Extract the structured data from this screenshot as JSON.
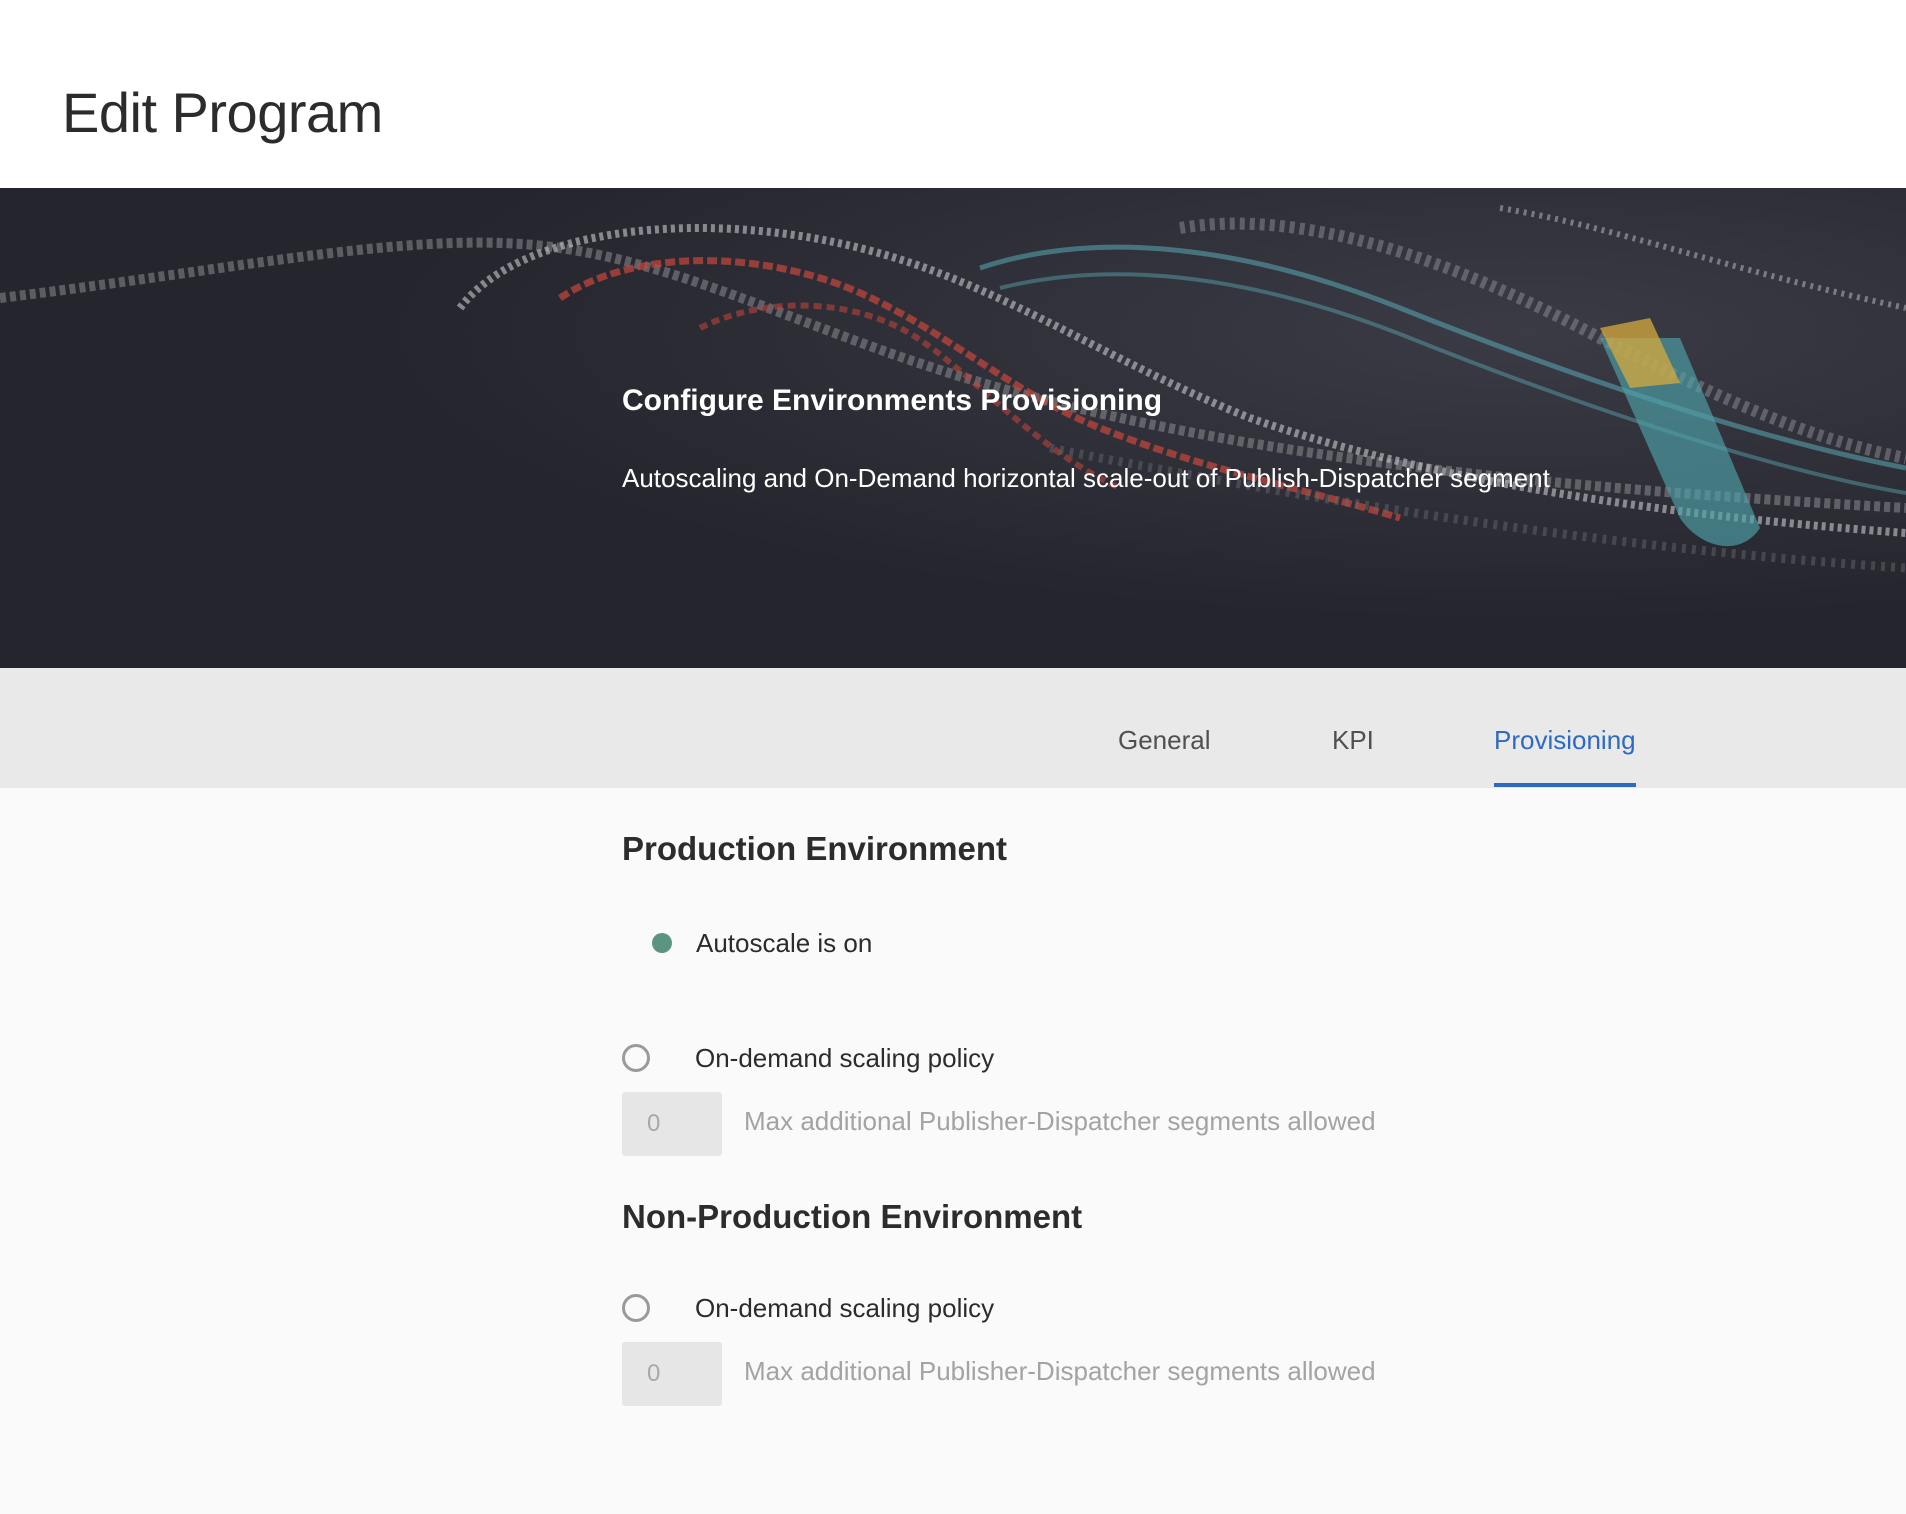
{
  "page": {
    "title": "Edit Program"
  },
  "hero": {
    "title": "Configure Environments Provisioning",
    "subtitle": "Autoscaling and On-Demand horizontal scale-out of Publish-Dispatcher segment"
  },
  "tabs": [
    {
      "label": "General",
      "active": false
    },
    {
      "label": "KPI",
      "active": false
    },
    {
      "label": "Provisioning",
      "active": true
    }
  ],
  "production": {
    "title": "Production Environment",
    "autoscale_status": "Autoscale is on",
    "policy_label": "On-demand scaling policy",
    "policy_selected": false,
    "max_segments_value": "0",
    "max_segments_help": "Max additional Publisher-Dispatcher segments allowed"
  },
  "non_production": {
    "title": "Non-Production Environment",
    "policy_label": "On-demand scaling policy",
    "policy_selected": false,
    "max_segments_value": "0",
    "max_segments_help": "Max additional Publisher-Dispatcher segments allowed"
  },
  "colors": {
    "accent": "#2d6ac4",
    "status_on": "#5c9482",
    "hero_background": "#25252e",
    "tabbar_background": "#e9e9e9"
  }
}
